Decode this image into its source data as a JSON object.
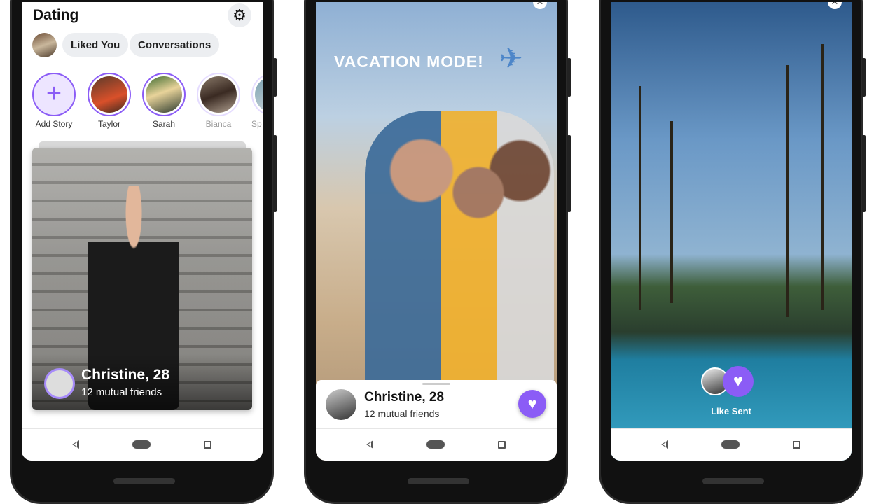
{
  "phone1": {
    "title": "Dating",
    "settings_icon": "gear-icon",
    "tabs": [
      {
        "label": "Liked You"
      },
      {
        "label": "Conversations"
      }
    ],
    "stories": [
      {
        "label": "Add Story"
      },
      {
        "label": "Taylor"
      },
      {
        "label": "Sarah"
      },
      {
        "label": "Bianca"
      },
      {
        "label": "Sp"
      }
    ],
    "card": {
      "name": "Christine, 28",
      "subtitle": "12 mutual friends"
    }
  },
  "phone2": {
    "overlay_text": "VACATION MODE!",
    "plane": "✈",
    "profile": {
      "name": "Christine, 28",
      "subtitle": "12 mutual friends"
    }
  },
  "phone3": {
    "status": "Like Sent"
  },
  "colors": {
    "accent": "#8b5cf6",
    "pill_bg": "#eceef1"
  }
}
